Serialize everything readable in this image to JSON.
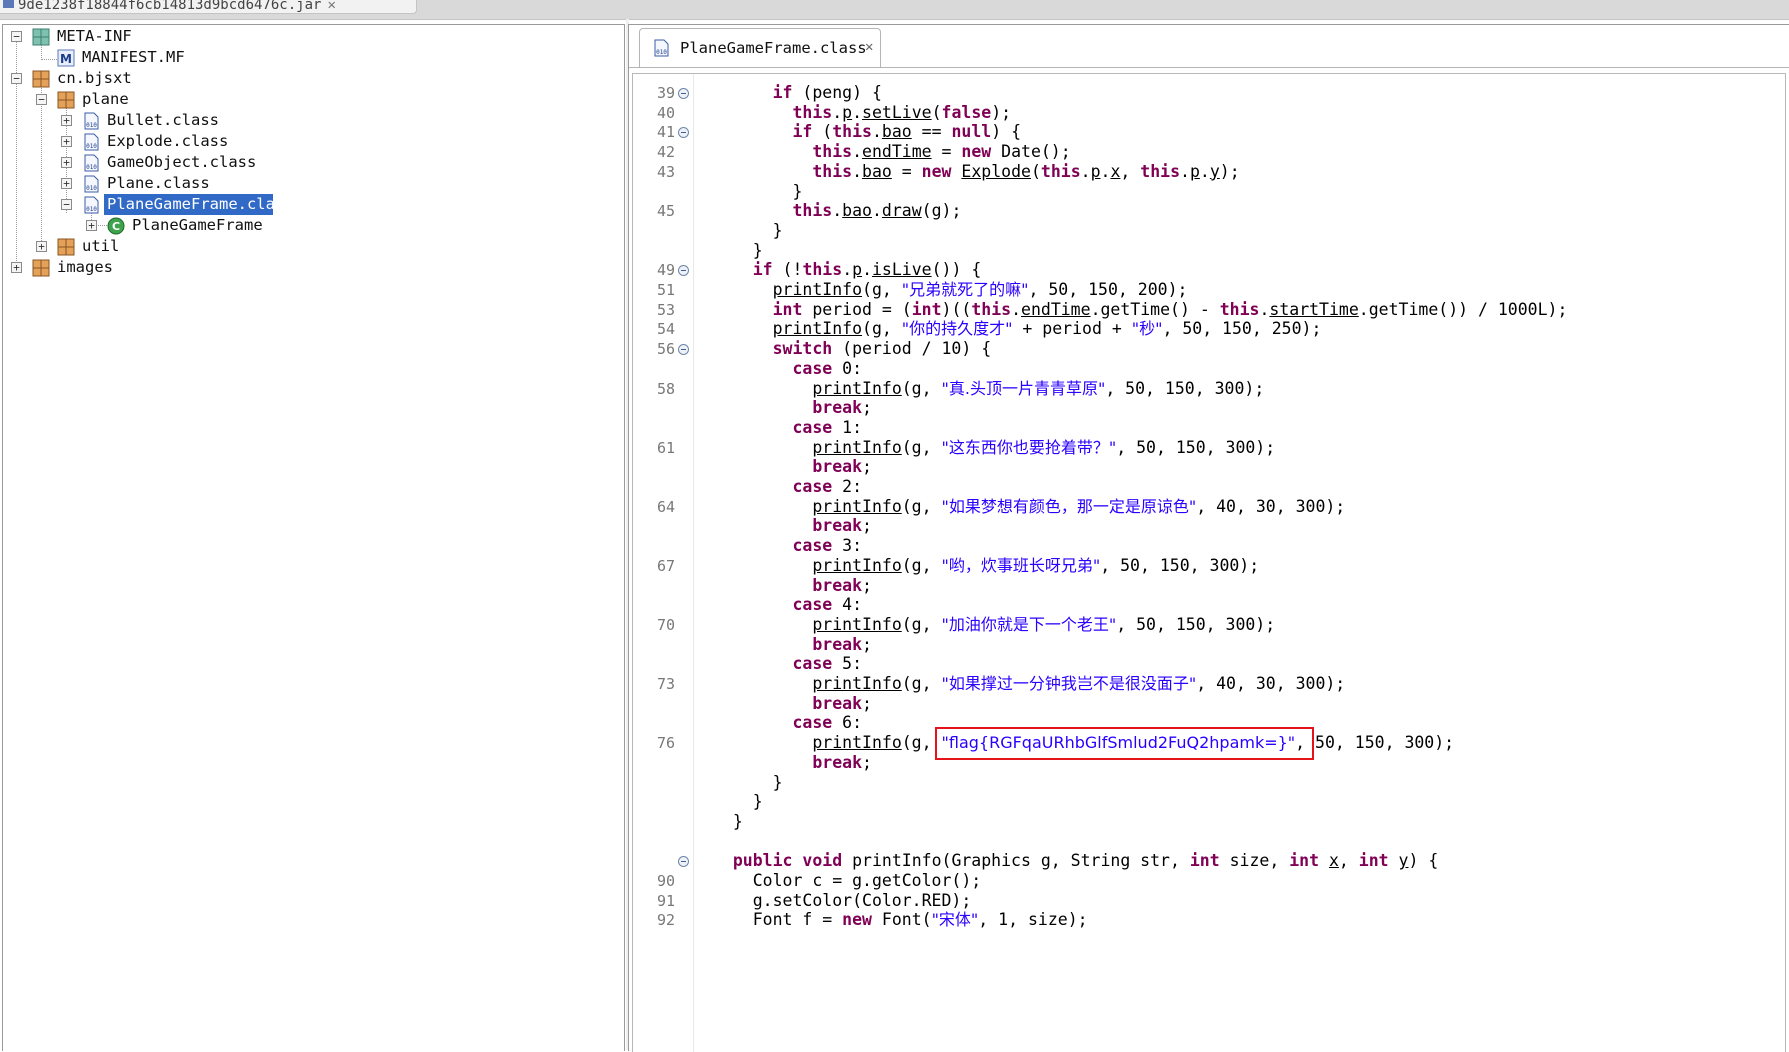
{
  "jar_tab": {
    "label": "9de1238f18844f6cb14813d9bcd6476c.jar"
  },
  "tree": {
    "meta_inf": "META-INF",
    "manifest": "MANIFEST.MF",
    "cn_bjsxt": "cn.bjsxt",
    "plane_pkg": "plane",
    "bullet": "Bullet.class",
    "explode": "Explode.class",
    "gameobject": "GameObject.class",
    "plane_class": "Plane.class",
    "planegameframe_class": "PlaneGameFrame.class",
    "planegameframe_type": "PlaneGameFrame",
    "util": "util",
    "images": "images"
  },
  "editor": {
    "tab_label": "PlaneGameFrame.class",
    "lines": [
      {
        "num": "39",
        "fold": true,
        "text": "      if (peng) {"
      },
      {
        "num": "40",
        "fold": false,
        "text": "        this.p.setLive(false);"
      },
      {
        "num": "41",
        "fold": true,
        "text": "        if (this.bao == null) {"
      },
      {
        "num": "42",
        "fold": false,
        "text": "          this.endTime = new Date();"
      },
      {
        "num": "43",
        "fold": false,
        "text": "          this.bao = new Explode(this.p.x, this.p.y);"
      },
      {
        "num": "",
        "fold": false,
        "text": "        }"
      },
      {
        "num": "45",
        "fold": false,
        "text": "        this.bao.draw(g);"
      },
      {
        "num": "",
        "fold": false,
        "text": "      }"
      },
      {
        "num": "",
        "fold": false,
        "text": "    }"
      },
      {
        "num": "49",
        "fold": true,
        "text": "    if (!this.p.isLive()) {"
      },
      {
        "num": "51",
        "fold": false,
        "text": "      printInfo(g, \"兄弟就死了的嘛\", 50, 150, 200);"
      },
      {
        "num": "53",
        "fold": false,
        "text": "      int period = (int)((this.endTime.getTime() - this.startTime.getTime()) / 1000L);"
      },
      {
        "num": "54",
        "fold": false,
        "text": "      printInfo(g, \"你的持久度才\" + period + \"秒\", 50, 150, 250);"
      },
      {
        "num": "56",
        "fold": true,
        "text": "      switch (period / 10) {"
      },
      {
        "num": "",
        "fold": false,
        "text": "        case 0:"
      },
      {
        "num": "58",
        "fold": false,
        "text": "          printInfo(g, \"真.头顶一片青青草原\", 50, 150, 300);"
      },
      {
        "num": "",
        "fold": false,
        "text": "          break;"
      },
      {
        "num": "",
        "fold": false,
        "text": "        case 1:"
      },
      {
        "num": "61",
        "fold": false,
        "text": "          printInfo(g, \"这东西你也要抢着带？\", 50, 150, 300);"
      },
      {
        "num": "",
        "fold": false,
        "text": "          break;"
      },
      {
        "num": "",
        "fold": false,
        "text": "        case 2:"
      },
      {
        "num": "64",
        "fold": false,
        "text": "          printInfo(g, \"如果梦想有颜色，那一定是原谅色\", 40, 30, 300);"
      },
      {
        "num": "",
        "fold": false,
        "text": "          break;"
      },
      {
        "num": "",
        "fold": false,
        "text": "        case 3:"
      },
      {
        "num": "67",
        "fold": false,
        "text": "          printInfo(g, \"哟，炊事班长呀兄弟\", 50, 150, 300);"
      },
      {
        "num": "",
        "fold": false,
        "text": "          break;"
      },
      {
        "num": "",
        "fold": false,
        "text": "        case 4:"
      },
      {
        "num": "70",
        "fold": false,
        "text": "          printInfo(g, \"加油你就是下一个老王\", 50, 150, 300);"
      },
      {
        "num": "",
        "fold": false,
        "text": "          break;"
      },
      {
        "num": "",
        "fold": false,
        "text": "        case 5:"
      },
      {
        "num": "73",
        "fold": false,
        "text": "          printInfo(g, \"如果撑过一分钟我岂不是很没面子\", 40, 30, 300);"
      },
      {
        "num": "",
        "fold": false,
        "text": "          break;"
      },
      {
        "num": "",
        "fold": false,
        "text": "        case 6:"
      },
      {
        "num": "76",
        "fold": false,
        "text": "          printInfo(g, \"flag{RGFqaURhbGlfSmlud2FuQ2hpamk=}\", 50, 150, 300);"
      },
      {
        "num": "",
        "fold": false,
        "text": "          break;"
      },
      {
        "num": "",
        "fold": false,
        "text": "      }"
      },
      {
        "num": "",
        "fold": false,
        "text": "    }"
      },
      {
        "num": "",
        "fold": false,
        "text": "  }"
      },
      {
        "num": "",
        "fold": false,
        "text": ""
      },
      {
        "num": "",
        "fold": true,
        "text": "  public void printInfo(Graphics g, String str, int size, int x, int y) {"
      },
      {
        "num": "90",
        "fold": false,
        "text": "    Color c = g.getColor();"
      },
      {
        "num": "91",
        "fold": false,
        "text": "    g.setColor(Color.RED);"
      },
      {
        "num": "92",
        "fold": false,
        "text": "    Font f = new Font(\"宋体\", 1, size);"
      }
    ]
  },
  "colors": {
    "keyword": "#7f0055",
    "string": "#2a00ff",
    "selection": "#3169c6",
    "highlight_box": "#e5141b"
  }
}
